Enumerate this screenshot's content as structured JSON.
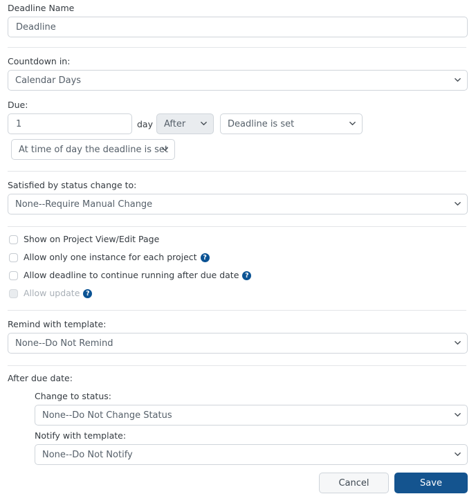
{
  "form": {
    "deadline_name": {
      "label": "Deadline Name",
      "value": "Deadline"
    },
    "countdown": {
      "label": "Countdown in:",
      "value": "Calendar Days"
    },
    "due": {
      "label": "Due:",
      "amount": "1",
      "unit_label": "day",
      "direction": "After",
      "anchor": "Deadline is set",
      "time_of_day": "At time of day the deadline is set"
    },
    "satisfied_by": {
      "label": "Satisfied by status change to:",
      "value": "None--Require Manual Change"
    },
    "options": [
      {
        "label": "Show on Project View/Edit Page",
        "checked": false,
        "disabled": false,
        "help": false
      },
      {
        "label": "Allow only one instance for each project",
        "checked": false,
        "disabled": false,
        "help": true,
        "help_glyph": "?"
      },
      {
        "label": "Allow deadline to continue running after due date",
        "checked": false,
        "disabled": false,
        "help": true,
        "help_glyph": "?"
      },
      {
        "label": "Allow update",
        "checked": false,
        "disabled": true,
        "help": true,
        "help_glyph": "?"
      }
    ],
    "remind": {
      "label": "Remind with template:",
      "value": "None--Do Not Remind"
    },
    "after_due_date": {
      "label": "After due date:",
      "change_status": {
        "label": "Change to status:",
        "value": "None--Do Not Change Status"
      },
      "notify": {
        "label": "Notify with template:",
        "value": "None--Do Not Notify"
      }
    }
  },
  "actions": {
    "cancel_label": "Cancel",
    "save_label": "Save"
  },
  "colors": {
    "primary": "#14548f",
    "help_badge": "#0b5394",
    "border": "#cfd4da",
    "divider": "#e3e5e8",
    "text": "#343a40",
    "control_text": "#56606a",
    "disabled_text": "#a9b0b7",
    "gray_control_bg": "#e9ecef"
  },
  "icons": {
    "chevron": "chevron-down-icon",
    "help": "help-circle-icon"
  }
}
